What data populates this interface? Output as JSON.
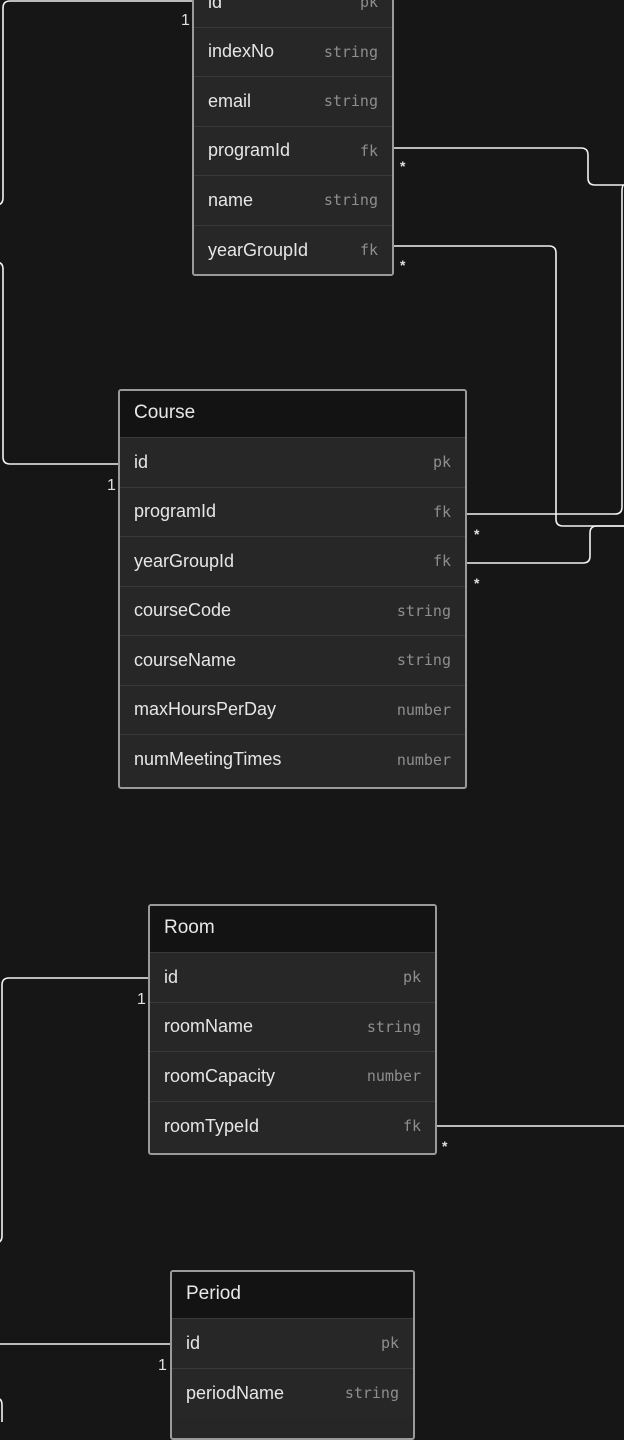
{
  "entities": {
    "student": {
      "fields": [
        {
          "name": "id",
          "type": "pk"
        },
        {
          "name": "indexNo",
          "type": "string"
        },
        {
          "name": "email",
          "type": "string"
        },
        {
          "name": "programId",
          "type": "fk"
        },
        {
          "name": "name",
          "type": "string"
        },
        {
          "name": "yearGroupId",
          "type": "fk"
        }
      ]
    },
    "course": {
      "title": "Course",
      "fields": [
        {
          "name": "id",
          "type": "pk"
        },
        {
          "name": "programId",
          "type": "fk"
        },
        {
          "name": "yearGroupId",
          "type": "fk"
        },
        {
          "name": "courseCode",
          "type": "string"
        },
        {
          "name": "courseName",
          "type": "string"
        },
        {
          "name": "maxHoursPerDay",
          "type": "number"
        },
        {
          "name": "numMeetingTimes",
          "type": "number"
        }
      ]
    },
    "room": {
      "title": "Room",
      "fields": [
        {
          "name": "id",
          "type": "pk"
        },
        {
          "name": "roomName",
          "type": "string"
        },
        {
          "name": "roomCapacity",
          "type": "number"
        },
        {
          "name": "roomTypeId",
          "type": "fk"
        }
      ]
    },
    "period": {
      "title": "Period",
      "fields": [
        {
          "name": "id",
          "type": "pk"
        },
        {
          "name": "periodName",
          "type": "string"
        }
      ]
    }
  },
  "cardinality": {
    "one": "1",
    "many": "*"
  },
  "colors": {
    "background": "#161616",
    "connector": "#f2f2f2",
    "border": "#9a9a9a"
  }
}
